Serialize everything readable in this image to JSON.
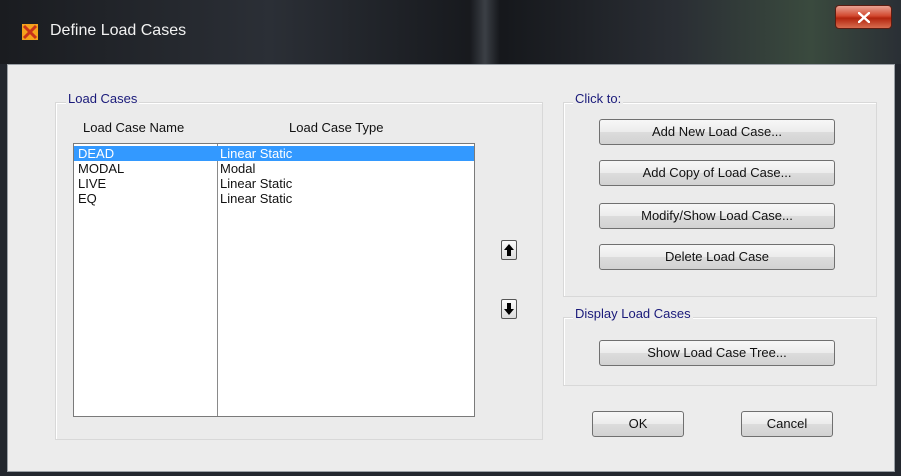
{
  "window": {
    "title": "Define Load Cases",
    "close_label": "x"
  },
  "load_cases": {
    "group_label": "Load Cases",
    "columns": [
      "Load Case Name",
      "Load Case Type"
    ],
    "rows": [
      {
        "name": "DEAD",
        "type": "Linear Static",
        "selected": true
      },
      {
        "name": "MODAL",
        "type": "Modal",
        "selected": false
      },
      {
        "name": "LIVE",
        "type": "Linear Static",
        "selected": false
      },
      {
        "name": "EQ",
        "type": "Linear Static",
        "selected": false
      }
    ]
  },
  "reorder": {
    "up_icon": "arrow-up-icon",
    "down_icon": "arrow-down-icon"
  },
  "click_to": {
    "group_label": "Click to:",
    "add_new": "Add New Load Case...",
    "add_copy": "Add Copy of Load Case...",
    "modify_show": "Modify/Show Load Case...",
    "delete": "Delete Load Case"
  },
  "display": {
    "group_label": "Display Load Cases",
    "show_tree": "Show Load Case Tree..."
  },
  "footer": {
    "ok": "OK",
    "cancel": "Cancel"
  },
  "colors": {
    "selection": "#3399ff",
    "group_label": "#1a1a7a",
    "close_button": "#c0391f"
  }
}
